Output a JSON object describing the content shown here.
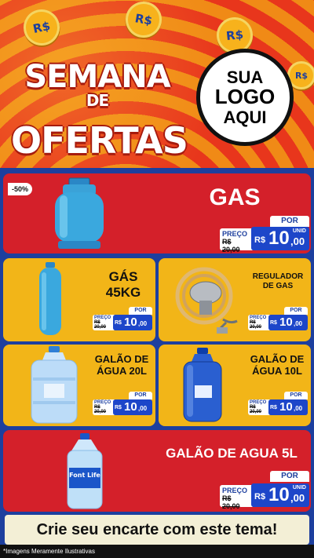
{
  "hero": {
    "coin_text": "R$",
    "title_line1": "SEMANA",
    "title_line1_small": "DE",
    "title_line2": "OFERTAS",
    "logo_lines": [
      "SUA",
      "LOGO",
      "AQUI"
    ]
  },
  "products": [
    {
      "name": "GAS",
      "badge": "-50%",
      "por": "POR",
      "preco": "PREÇO",
      "old_price": "R$ 20,00",
      "currency": "R$",
      "price_int": "10",
      "price_dec": ",00",
      "unit": "UNID",
      "image": "gas-cylinder-icon"
    },
    {
      "name_line1": "GÁS",
      "name_line2": "45KG",
      "por": "POR",
      "preco": "PREÇO",
      "old_price": "R$ 20,00",
      "currency": "R$",
      "price_int": "10",
      "price_dec": ",00",
      "unit": "UNID",
      "image": "tall-gas-cylinder-icon"
    },
    {
      "name_line1": "REGULADOR",
      "name_line2": "DE GAS",
      "por": "POR",
      "preco": "PREÇO",
      "old_price": "R$ 20,00",
      "currency": "R$",
      "price_int": "10",
      "price_dec": ",00",
      "unit": "UNID",
      "image": "gas-regulator-icon"
    },
    {
      "name_line1": "GALÃO DE",
      "name_line2": "ÁGUA 20L",
      "por": "POR",
      "preco": "PREÇO",
      "old_price": "R$ 20,00",
      "currency": "R$",
      "price_int": "10",
      "price_dec": ",00",
      "unit": "UNID",
      "image": "water-jug-20l-icon"
    },
    {
      "name_line1": "GALÃO DE",
      "name_line2": "ÁGUA 10L",
      "por": "POR",
      "preco": "PREÇO",
      "old_price": "R$ 20,00",
      "currency": "R$",
      "price_int": "10",
      "price_dec": ",00",
      "unit": "UNID",
      "image": "water-jug-10l-icon"
    },
    {
      "name": "GALÃO DE AGUA 5L",
      "por": "POR",
      "preco": "PREÇO",
      "old_price": "R$ 20,00",
      "currency": "R$",
      "price_int": "10",
      "price_dec": ",00",
      "unit": "UNID",
      "image": "water-bottle-5l-icon",
      "bottle_brand": "Font Life"
    }
  ],
  "footer": {
    "cta": "Crie seu encarte com este tema!",
    "note": "*Imagens Meramente Ilustrativas"
  },
  "colors": {
    "card_red": "#d4202a",
    "card_yellow": "#f2b518",
    "background_blue": "#1d3f9e",
    "price_blue": "#1d46c9"
  }
}
